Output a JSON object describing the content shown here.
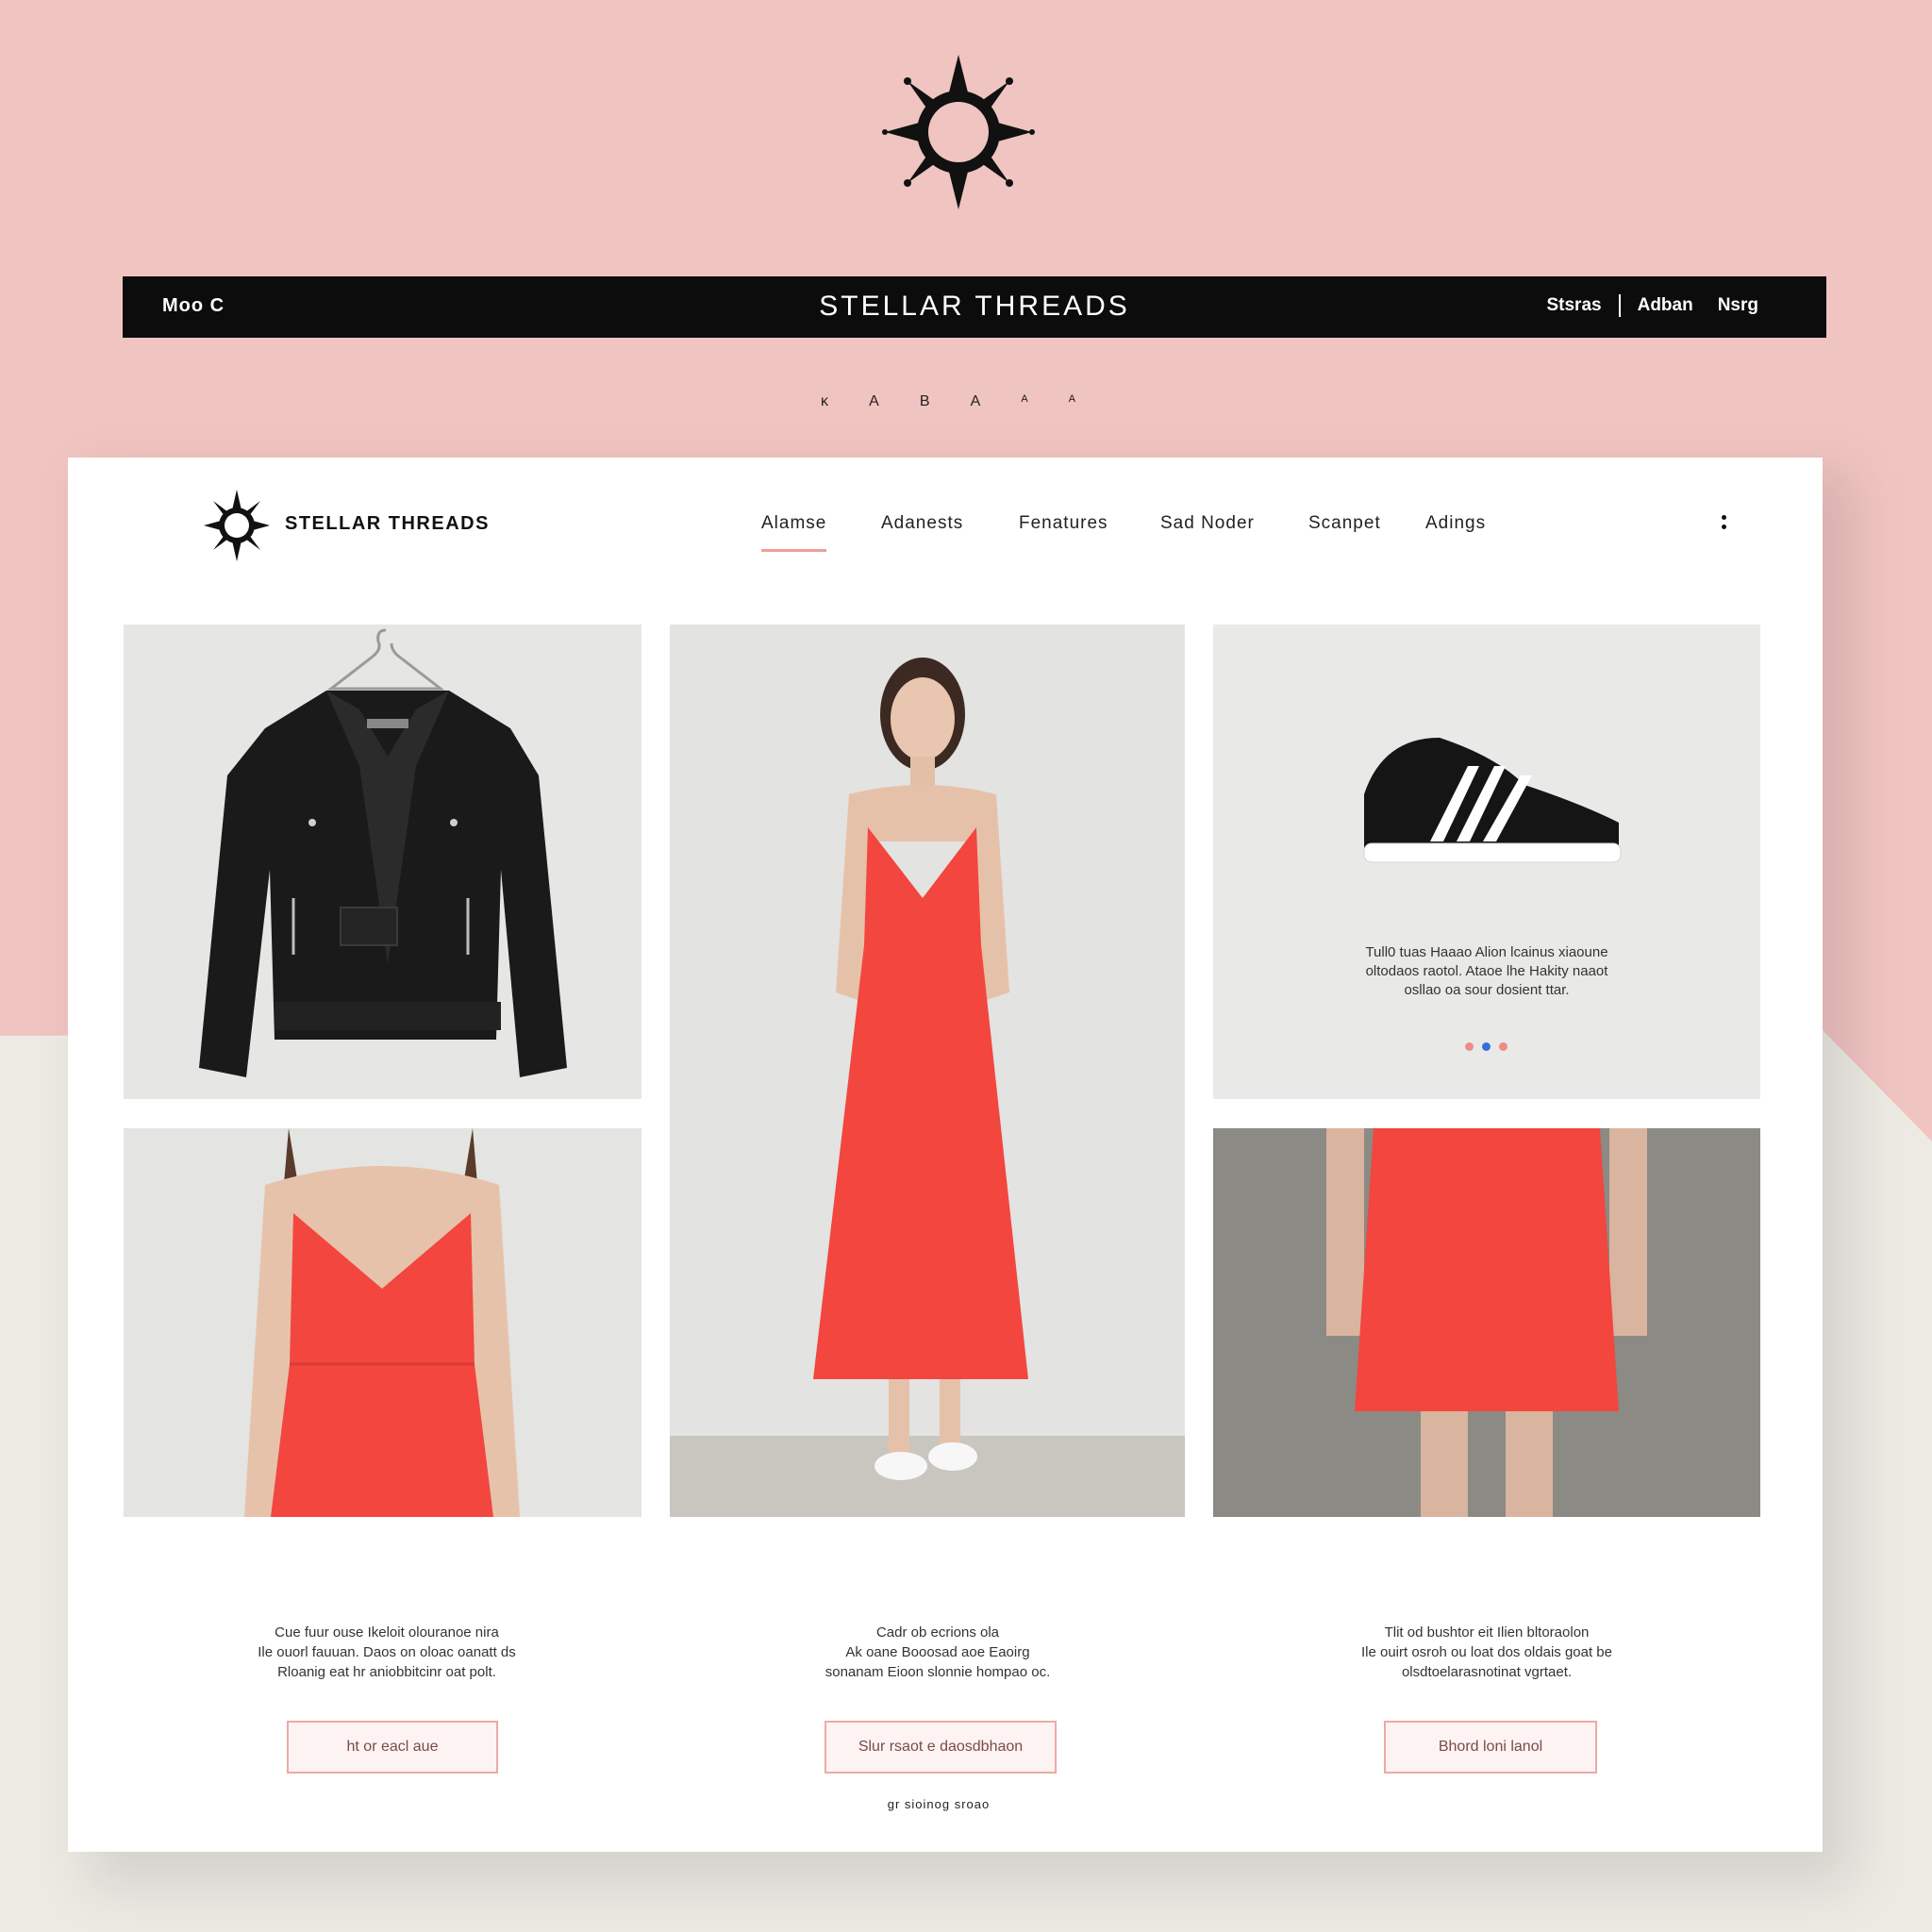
{
  "banner": {
    "left_text": "Moo C",
    "title": "STELLAR THREADS",
    "links": [
      "Stsras",
      "Adban",
      "Nsrg"
    ]
  },
  "sub_icons": [
    "ĸ",
    "A",
    "B",
    "A",
    "ᴬ",
    "ᴬ"
  ],
  "nav": {
    "brand": "STELLAR THREADS",
    "links": [
      {
        "label": "Alamse",
        "active": true
      },
      {
        "label": "Adanests",
        "active": false
      },
      {
        "label": "Fenatures",
        "active": false
      },
      {
        "label": "Sad Noder",
        "active": false
      },
      {
        "label": "Scanpet",
        "active": false
      },
      {
        "label": "Adings",
        "active": false
      }
    ]
  },
  "shoe_panel": {
    "lines": [
      "Tull0 tuas Haaao Alion lcainus xiaoune",
      "oltodaos raotol. Ataoe lhe Hakity naaot",
      "osllao oa sour dosient ttar."
    ],
    "dot_colors": [
      "#f08b86",
      "#3a6fd8",
      "#f08b86"
    ]
  },
  "columns": [
    {
      "lines": [
        "Cue fuur ouse Ikeloit olouranoe nira",
        "Ile ouorl fauuan. Daos on oloac oanatt ds",
        "Rloanig eat hr aniobbitcinr oat polt."
      ],
      "cta": "ht or eacl aue"
    },
    {
      "lines": [
        "Cadr ob ecrions ola",
        "Ak oane Booosad aoe Eaoirg",
        "sonanam Eioon slonnie hompao oc."
      ],
      "cta": "Slur rsaot e daosdbhaon"
    },
    {
      "lines": [
        "Tlit od bushtor eit Ilien bltoraolon",
        "Ile ouirt osroh ou loat dos oldais goat be",
        "olsdtoelarasnotinat vgrtaet."
      ],
      "cta": "Bhord loni lanol"
    }
  ],
  "footnote": "gr sioinog sroao",
  "colors": {
    "pink_bg": "#f0c4c1",
    "banner": "#0c0c0c",
    "accent": "#ef9d99",
    "dress_red": "#f2463f"
  },
  "icons": [
    "star-sun-logo-icon",
    "kebab-menu-icon"
  ]
}
